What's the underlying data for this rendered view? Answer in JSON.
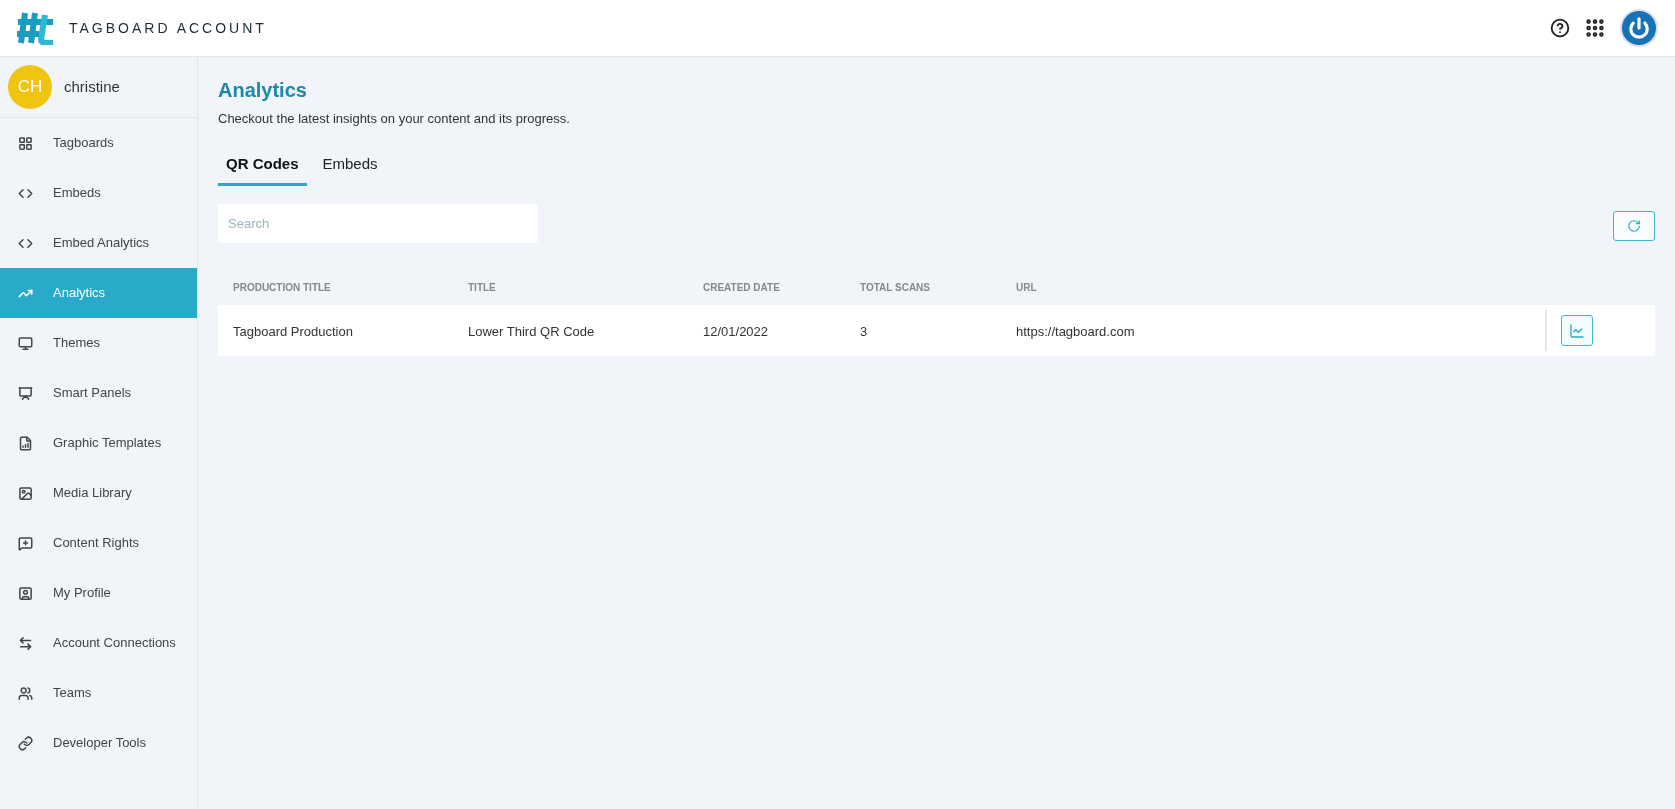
{
  "header": {
    "title": "TAGBOARD ACCOUNT"
  },
  "user": {
    "initials": "CH",
    "name": "christine"
  },
  "sidebar": {
    "items": [
      {
        "label": "Tagboards",
        "selected": false
      },
      {
        "label": "Embeds",
        "selected": false
      },
      {
        "label": "Embed Analytics",
        "selected": false
      },
      {
        "label": "Analytics",
        "selected": true
      },
      {
        "label": "Themes",
        "selected": false
      },
      {
        "label": "Smart Panels",
        "selected": false
      },
      {
        "label": "Graphic Templates",
        "selected": false
      },
      {
        "label": "Media Library",
        "selected": false
      },
      {
        "label": "Content Rights",
        "selected": false
      },
      {
        "label": "My Profile",
        "selected": false
      },
      {
        "label": "Account Connections",
        "selected": false
      },
      {
        "label": "Teams",
        "selected": false
      },
      {
        "label": "Developer Tools",
        "selected": false
      }
    ]
  },
  "page": {
    "title": "Analytics",
    "subtitle": "Checkout the latest insights on your content and its progress."
  },
  "tabs": [
    {
      "label": "QR Codes",
      "selected": true
    },
    {
      "label": "Embeds",
      "selected": false
    }
  ],
  "search": {
    "placeholder": "Search"
  },
  "table": {
    "columns": [
      "PRODUCTION TITLE",
      "TITLE",
      "CREATED DATE",
      "TOTAL SCANS",
      "URL"
    ],
    "rows": [
      [
        "Tagboard Production",
        "Lower Third QR Code",
        "12/01/2022",
        "3",
        "https://tagboard.com"
      ]
    ]
  }
}
